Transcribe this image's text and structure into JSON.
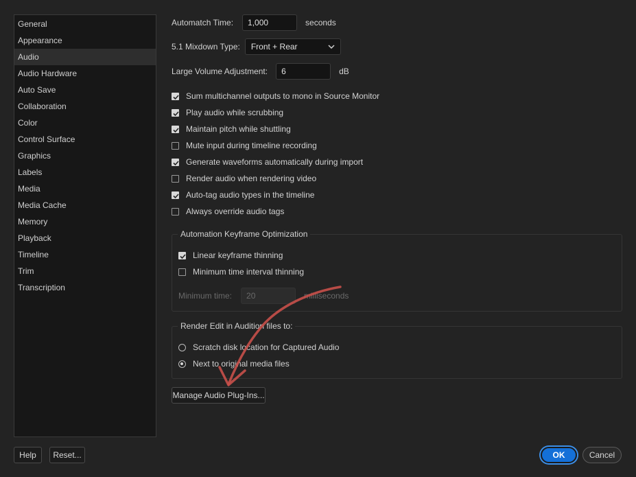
{
  "sidebar": {
    "items": [
      {
        "label": "General"
      },
      {
        "label": "Appearance"
      },
      {
        "label": "Audio"
      },
      {
        "label": "Audio Hardware"
      },
      {
        "label": "Auto Save"
      },
      {
        "label": "Collaboration"
      },
      {
        "label": "Color"
      },
      {
        "label": "Control Surface"
      },
      {
        "label": "Graphics"
      },
      {
        "label": "Labels"
      },
      {
        "label": "Media"
      },
      {
        "label": "Media Cache"
      },
      {
        "label": "Memory"
      },
      {
        "label": "Playback"
      },
      {
        "label": "Timeline"
      },
      {
        "label": "Trim"
      },
      {
        "label": "Transcription"
      }
    ],
    "selected": "Audio"
  },
  "settings": {
    "automatch": {
      "label": "Automatch Time:",
      "value": "1,000",
      "unit": "seconds"
    },
    "mixdown": {
      "label": "5.1 Mixdown Type:",
      "value": "Front + Rear"
    },
    "volume": {
      "label": "Large Volume Adjustment:",
      "value": "6",
      "unit": "dB"
    },
    "checkboxes": [
      {
        "label": "Sum multichannel outputs to mono in Source Monitor",
        "checked": true
      },
      {
        "label": "Play audio while scrubbing",
        "checked": true
      },
      {
        "label": "Maintain pitch while shuttling",
        "checked": true
      },
      {
        "label": "Mute input during timeline recording",
        "checked": false
      },
      {
        "label": "Generate waveforms automatically during import",
        "checked": true
      },
      {
        "label": "Render audio when rendering video",
        "checked": false
      },
      {
        "label": "Auto-tag audio types in the timeline",
        "checked": true
      },
      {
        "label": "Always override audio tags",
        "checked": false
      }
    ]
  },
  "keyframe_group": {
    "title": "Automation Keyframe Optimization",
    "linear": {
      "label": "Linear keyframe thinning",
      "checked": true
    },
    "minimum": {
      "label": "Minimum time interval thinning",
      "checked": false
    },
    "min_time": {
      "label": "Minimum time:",
      "value": "20",
      "unit": "milliseconds"
    }
  },
  "render_group": {
    "title": "Render Edit in Audition files to:",
    "options": [
      {
        "label": "Scratch disk location for Captured Audio",
        "selected": false
      },
      {
        "label": "Next to original media files",
        "selected": true
      }
    ]
  },
  "buttons": {
    "manage_plugins": "Manage Audio Plug-Ins...",
    "help": "Help",
    "reset": "Reset...",
    "ok": "OK",
    "cancel": "Cancel"
  },
  "colors": {
    "accent": "#1470d8",
    "annotation_arrow": "#c8504a"
  }
}
